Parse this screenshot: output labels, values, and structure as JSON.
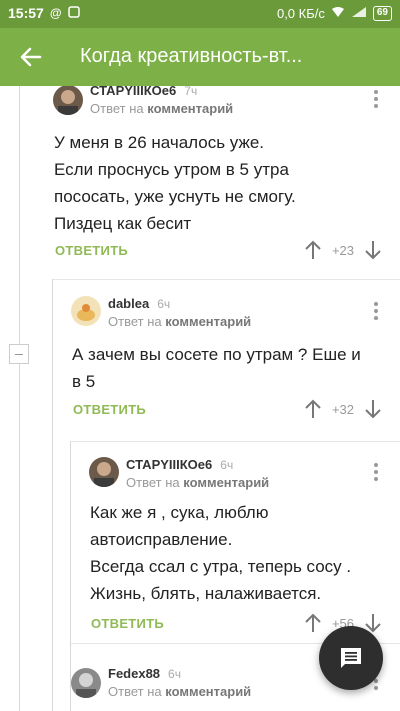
{
  "status_bar": {
    "time": "15:57",
    "network_speed": "0,0 КБ/с",
    "battery": "69"
  },
  "app_bar": {
    "title": "Когда креативность-вт..."
  },
  "comments": [
    {
      "author": "СТАРYIIIКОе6",
      "time": "7ч",
      "reply_prefix": "Ответ на",
      "reply_target": "комментарий",
      "lines": [
        "У меня в 26 началось уже.",
        "Если проснусь утром в 5 утра",
        "пососать, уже уснуть не смогу.",
        "Пиздец как бесит"
      ],
      "reply_label": "ОТВЕТИТЬ",
      "score": "+23"
    },
    {
      "author": "dablea",
      "time": "6ч",
      "reply_prefix": "Ответ на",
      "reply_target": "комментарий",
      "lines": [
        "А зачем вы сосете по утрам ? Еше и",
        "в 5"
      ],
      "reply_label": "ОТВЕТИТЬ",
      "score": "+32"
    },
    {
      "author": "СТАРYIIIКОе6",
      "time": "6ч",
      "reply_prefix": "Ответ на",
      "reply_target": "комментарий",
      "lines": [
        "Как же я , сука, люблю",
        "автоисправление.",
        "Всегда ссал с утра, теперь сосу .",
        "Жизнь, блять, налаживается."
      ],
      "reply_label": "ОТВЕТИТЬ",
      "score": "+56"
    },
    {
      "author": "Fedex88",
      "time": "6ч",
      "reply_prefix": "Ответ на",
      "reply_target": "комментарий"
    }
  ],
  "colors": {
    "status_bar": "#6a9a3a",
    "app_bar": "#7db046",
    "accent": "#8fba55",
    "fab": "#2e2e2e"
  }
}
